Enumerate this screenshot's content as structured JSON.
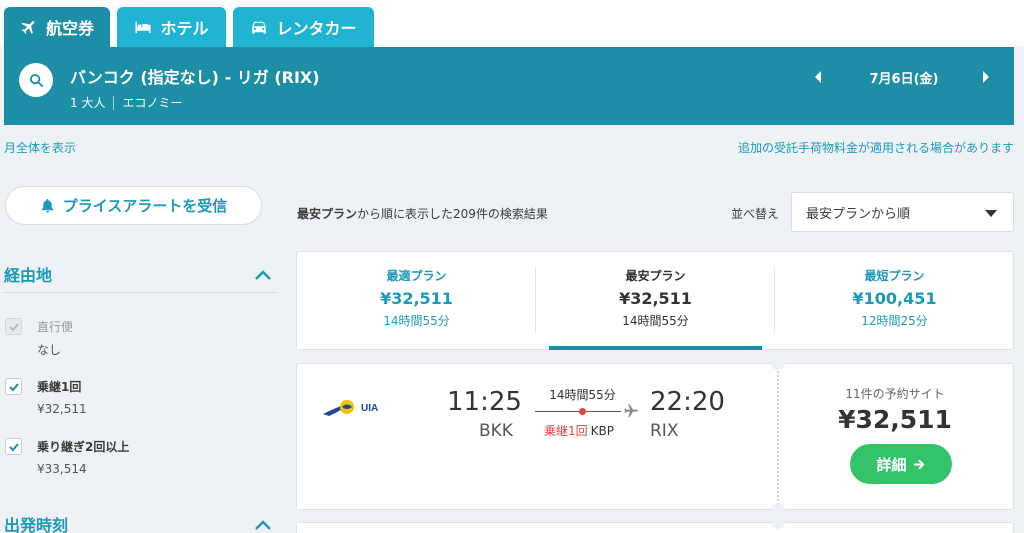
{
  "tabs": [
    {
      "label": "航空券",
      "icon": "airplane-icon"
    },
    {
      "label": "ホテル",
      "icon": "bed-icon"
    },
    {
      "label": "レンタカー",
      "icon": "car-icon"
    }
  ],
  "search": {
    "route": "バンコク (指定なし) - リガ (RIX)",
    "passengers": "1 大人",
    "cabin": "エコノミー",
    "date": "7月6日(金)"
  },
  "links": {
    "show_month": "月全体を表示",
    "baggage_notice": "追加の受託手荷物料金が適用される場合があります"
  },
  "sidebar": {
    "price_alert": "プライスアラートを受信",
    "stops_title": "経由地",
    "stops": [
      {
        "label": "直行便",
        "sub": "なし",
        "checked": true,
        "disabled": true
      },
      {
        "label": "乗継1回",
        "sub": "¥32,511",
        "checked": true,
        "disabled": false
      },
      {
        "label": "乗り継ぎ2回以上",
        "sub": "¥33,514",
        "checked": true,
        "disabled": false
      }
    ],
    "departure_title": "出発時刻"
  },
  "results": {
    "count_bold": "最安プラン",
    "count_rest": "から順に表示した209件の検索結果",
    "sort_label": "並べ替え",
    "sort_value": "最安プランから順"
  },
  "summary": [
    {
      "title": "最適プラン",
      "price": "¥32,511",
      "duration": "14時間55分"
    },
    {
      "title": "最安プラン",
      "price": "¥32,511",
      "duration": "14時間55分"
    },
    {
      "title": "最短プラン",
      "price": "¥100,451",
      "duration": "12時間25分"
    }
  ],
  "flight": {
    "airline": "UIA",
    "dep_time": "11:25",
    "dep_code": "BKK",
    "arr_time": "22:20",
    "arr_code": "RIX",
    "duration": "14時間55分",
    "stops": "乗継1回",
    "via": "KBP",
    "sites": "11件の予約サイト",
    "price": "¥32,511",
    "detail_label": "詳細"
  },
  "colors": {
    "brand": "#1c8ea6",
    "tab": "#21b4d2",
    "link": "#1c9ab8",
    "cta": "#34c369",
    "stop": "#e64040"
  }
}
